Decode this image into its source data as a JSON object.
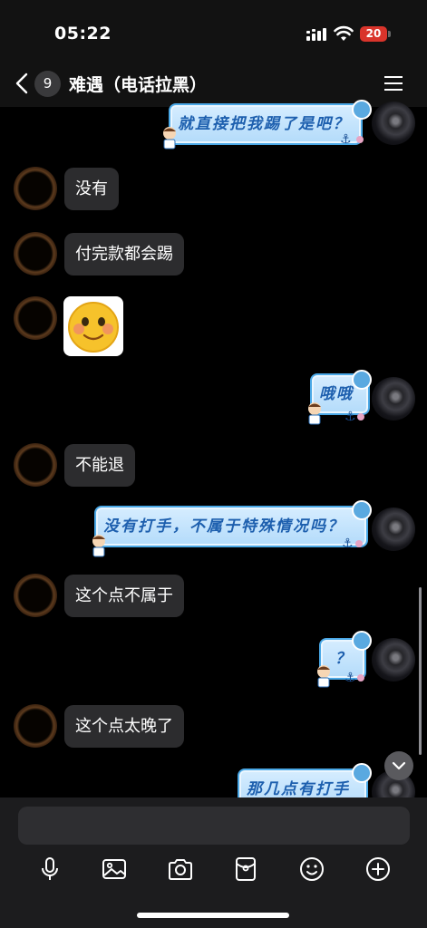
{
  "status_bar": {
    "time": "05:22",
    "battery_level": "20"
  },
  "nav": {
    "unread_count": "9",
    "title": "难遇（电话拉黑）"
  },
  "messages": {
    "m1": {
      "side": "right",
      "text": "就直接把我踢了是吧？"
    },
    "m2": {
      "side": "left",
      "text": "没有"
    },
    "m3": {
      "side": "left",
      "text": "付完款都会踢"
    },
    "m4": {
      "side": "left",
      "type": "sticker",
      "icon": "blushing-smiley-emoji"
    },
    "m5": {
      "side": "right",
      "text": "哦哦"
    },
    "m6": {
      "side": "left",
      "text": "不能退"
    },
    "m7": {
      "side": "right",
      "text": "没有打手，不属于特殊情况吗？"
    },
    "m8": {
      "side": "left",
      "text": "这个点不属于"
    },
    "m9": {
      "side": "right",
      "text": "？"
    },
    "m10": {
      "side": "left",
      "text": "这个点太晚了"
    },
    "m11": {
      "side": "right",
      "text": "那几点有打手"
    }
  },
  "composer": {
    "input_value": "",
    "tools": [
      "microphone-icon",
      "image-icon",
      "camera-icon",
      "red-packet-icon",
      "emoji-icon",
      "plus-icon"
    ]
  },
  "colors": {
    "bubble_left": "#2c2c2e",
    "bubble_right_fill": "#c4e3fb",
    "bubble_right_text": "#1d5fae",
    "battery": "#d9342b"
  }
}
